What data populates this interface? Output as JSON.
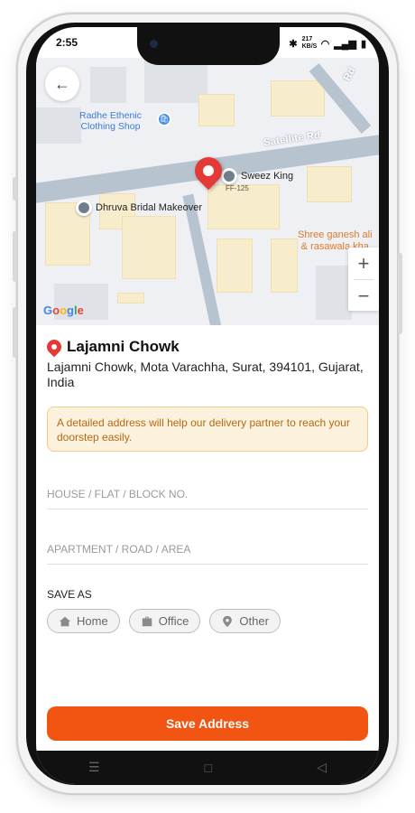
{
  "status": {
    "time": "2:55",
    "right": "217 KB/S"
  },
  "map": {
    "road_label": "Satellite Rd",
    "road_label_2": "Rd",
    "pois": [
      {
        "name": "Radhe Ethenic",
        "sub": "Clothing Shop"
      },
      {
        "name": "Sweez King"
      },
      {
        "name": "Dhruva Bridal Makeover"
      }
    ],
    "orange_place_line1": "Shree ganesh ali",
    "orange_place_line2": "& rasawala kha",
    "pin_label": "FF-125",
    "zoom_in": "+",
    "zoom_out": "−",
    "google": [
      "G",
      "o",
      "o",
      "g",
      "l",
      "e"
    ]
  },
  "place": {
    "title": "Lajamni Chowk",
    "address": "Lajamni Chowk, Mota Varachha, Surat, 394101, Gujarat, India"
  },
  "notice": "A detailed address will help our delivery partner to reach your doorstep easily.",
  "form": {
    "house_placeholder": "HOUSE / FLAT / BLOCK NO.",
    "apartment_placeholder": "APARTMENT / ROAD / AREA",
    "save_as_label": "SAVE AS",
    "chips": [
      {
        "label": "Home"
      },
      {
        "label": "Office"
      },
      {
        "label": "Other"
      }
    ]
  },
  "save_button": "Save Address",
  "navbar": {
    "menu": "☰",
    "home": "□",
    "back": "◁"
  },
  "colors": {
    "accent": "#f15511",
    "pin": "#e53935",
    "notice_bg": "#fcf1dc",
    "notice_text": "#b36a17"
  }
}
